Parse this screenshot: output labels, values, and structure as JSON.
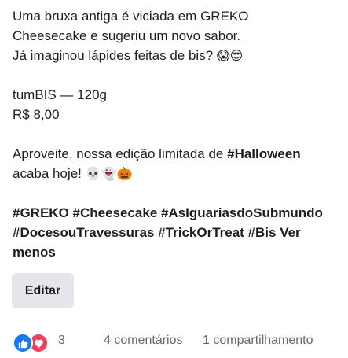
{
  "post": {
    "lines": [
      "Uma bruxa antiga é viciada em GREKO",
      "Cheesecake e sugeriu um novo sabor.",
      "Já imaginou lápides feitas de bis?"
    ],
    "line3_emojis": "😱😍",
    "product_name": "tumBIS — 120g",
    "price": "R$ 8,00",
    "promo_prefix": "Aproveite, nossa edição limitada de ",
    "promo_hashtag": "#Halloween",
    "promo_suffix": "acaba hoje! ",
    "promo_emojis": "💀👻🎃",
    "hashtags_line1": "#GREKO #Cheesecake #AsIguariasdoSubmundo",
    "hashtags_line2": "#DocesouTravessuras #TrickOrTreat #Bis Ver",
    "hashtags_line3": "menos"
  },
  "actions": {
    "edit_label": "Editar"
  },
  "footer": {
    "reaction_count": "3",
    "comments": "4 comentários",
    "shares": "1 compartilhamento"
  },
  "colors": {
    "like": "#1877f2",
    "love": "#f33e58",
    "button_bg": "#e4e6eb",
    "secondary_text": "#65676b"
  },
  "icons": {
    "like": "thumbs-up-icon",
    "love": "heart-icon"
  }
}
